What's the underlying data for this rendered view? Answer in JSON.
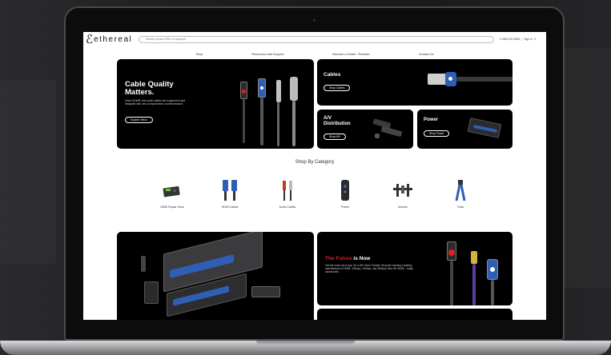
{
  "site": {
    "logo_text": "ethereal",
    "search_placeholder": "Search product SKU or keyword",
    "header_phone": "+1.866.330.0554",
    "header_divider": "|",
    "header_login": "Sign In",
    "header_cart": "0"
  },
  "nav": [
    "Shop",
    "Resources and Support",
    "Become a Dealer / Reseller",
    "Contact Us"
  ],
  "hero": {
    "title": "Cable Quality Matters.",
    "text": "Velox HDMI® and audio cables are engineered and designed with zero compromises on performance.",
    "button": "Explore Velox"
  },
  "tiles": {
    "cables": {
      "title": "Cables",
      "button": "Shop Cables"
    },
    "av": {
      "title": "A/V Distribution",
      "button": "Shop A/V"
    },
    "power": {
      "title": "Power",
      "button": "Shop Power"
    }
  },
  "category_heading": "Shop By Category",
  "categories": [
    {
      "label": "HDMI Repair Tools",
      "icon": "hdmi-repair-tool-icon"
    },
    {
      "label": "HDMI Cables",
      "icon": "hdmi-cable-icon"
    },
    {
      "label": "Audio Cables",
      "icon": "audio-cable-icon"
    },
    {
      "label": "Power",
      "icon": "power-device-icon"
    },
    {
      "label": "Mounts",
      "icon": "tv-mount-icon"
    },
    {
      "label": "Tools",
      "icon": "crimp-tool-icon"
    }
  ],
  "future": {
    "title_accent": "The Future",
    "title_rest": " is Now",
    "text": "Get the most out of your 4K or 8K Home Theater. Shop the industry's leading manufacturer of HDMI, 10Gbps, 24Gbps, and 48Gbps Ultra HD 4K/8K - ready accessories."
  },
  "colors": {
    "accent_red": "#e31e24",
    "tile_black": "#000000",
    "cable_blue": "#2f5fb4"
  }
}
